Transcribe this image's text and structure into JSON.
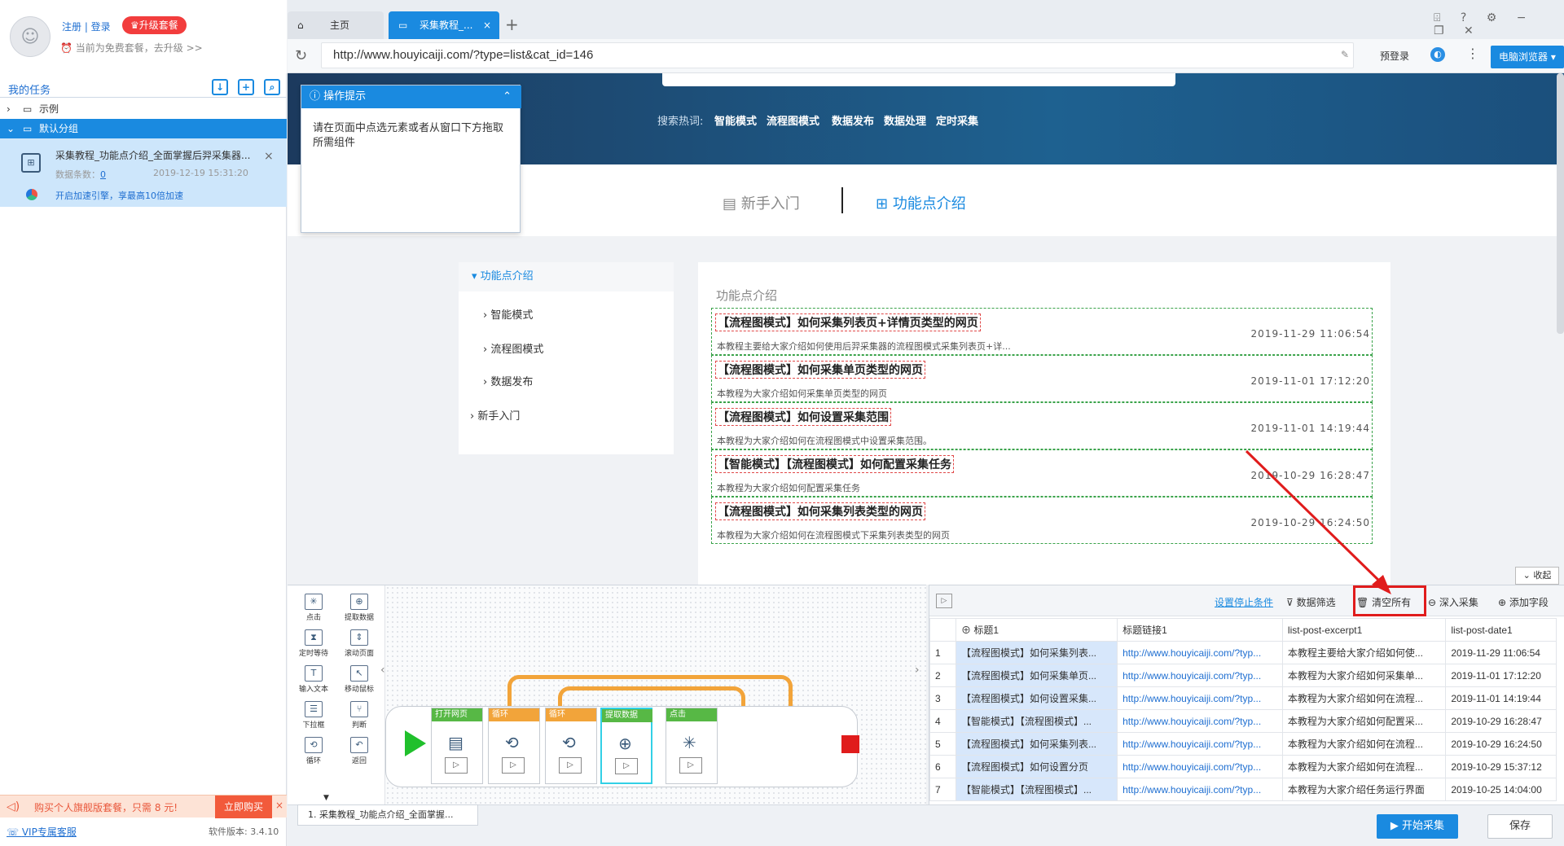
{
  "account": {
    "register_login": "注册 | 登录",
    "upgrade": "♛升级套餐",
    "plan_text": "当前为免费套餐，去升级 >>"
  },
  "tasks": {
    "header": "我的任务",
    "example_folder": "示例",
    "default_folder": "默认分组",
    "task_title": "采集教程_功能点介绍_全面掌握后羿采集器...",
    "task_count_label": "数据条数：",
    "task_count": "0",
    "task_time": "2019-12-19 15:31:20",
    "boost_text": "开启加速引擎，享最高10倍加速"
  },
  "promo": {
    "text": "购买个人旗舰版套餐，只需 8 元!",
    "buy": "立即购买"
  },
  "footer": {
    "vip": "VIP专属客服",
    "version": "软件版本: 3.4.10"
  },
  "browser": {
    "tab_home": "主页",
    "tab_active": "采集教程_...",
    "url": "http://www.houyicaiji.com/?type=list&cat_id=146",
    "prelogin": "预登录",
    "pc_browser": "电脑浏览器 ▾"
  },
  "page": {
    "hot_label": "搜索热词:",
    "hot_words": [
      "智能模式",
      "流程图模式",
      "数据发布",
      "数据处理",
      "定时采集"
    ],
    "nav_beginner": "新手入门",
    "nav_features": "功能点介绍",
    "menu_head": "功能点介绍",
    "menu_items": [
      "智能模式",
      "流程图模式",
      "数据发布",
      "新手入门"
    ],
    "content_title": "功能点介绍",
    "articles": [
      {
        "title": "【流程图模式】如何采集列表页+详情页类型的网页",
        "date": "2019-11-29 11:06:54",
        "excerpt": "本教程主要给大家介绍如何使用后羿采集器的流程图模式采集列表页+详..."
      },
      {
        "title": "【流程图模式】如何采集单页类型的网页",
        "date": "2019-11-01 17:12:20",
        "excerpt": "本教程为大家介绍如何采集单页类型的网页"
      },
      {
        "title": "【流程图模式】如何设置采集范围",
        "date": "2019-11-01 14:19:44",
        "excerpt": "本教程为大家介绍如何在流程图模式中设置采集范围。"
      },
      {
        "title": "【智能模式】【流程图模式】如何配置采集任务",
        "date": "2019-10-29 16:28:47",
        "excerpt": "本教程为大家介绍如何配置采集任务"
      },
      {
        "title": "【流程图模式】如何采集列表类型的网页",
        "date": "2019-10-29 16:24:50",
        "excerpt": "本教程为大家介绍如何在流程图模式下采集列表类型的网页"
      }
    ]
  },
  "tips": {
    "title": "操作提示",
    "body": "请在页面中点选元素或者从窗口下方拖取所需组件"
  },
  "collapse": "收起",
  "palette": [
    "点击",
    "提取数据",
    "定时等待",
    "滚动页面",
    "输入文本",
    "移动鼠标",
    "下拉框",
    "判断",
    "循环",
    "返回"
  ],
  "flow_nodes": [
    "打开网页",
    "循环",
    "循环",
    "提取数据",
    "点击"
  ],
  "flow_tab": "1. 采集教程_功能点介绍_全面掌握...",
  "data_toolbar": {
    "stop_cond": "设置停止条件",
    "filter": "数据筛选",
    "clear_all": "清空所有",
    "deep": "深入采集",
    "add_field": "添加字段"
  },
  "grid": {
    "columns": [
      "标题1",
      "标题链接1",
      "list-post-excerpt1",
      "list-post-date1"
    ],
    "rows": [
      [
        "1",
        "【流程图模式】如何采集列表...",
        "http://www.houyicaiji.com/?typ...",
        "本教程主要给大家介绍如何使...",
        "2019-11-29 11:06:54"
      ],
      [
        "2",
        "【流程图模式】如何采集单页...",
        "http://www.houyicaiji.com/?typ...",
        "本教程为大家介绍如何采集单...",
        "2019-11-01 17:12:20"
      ],
      [
        "3",
        "【流程图模式】如何设置采集...",
        "http://www.houyicaiji.com/?typ...",
        "本教程为大家介绍如何在流程...",
        "2019-11-01 14:19:44"
      ],
      [
        "4",
        "【智能模式】【流程图模式】...",
        "http://www.houyicaiji.com/?typ...",
        "本教程为大家介绍如何配置采...",
        "2019-10-29 16:28:47"
      ],
      [
        "5",
        "【流程图模式】如何采集列表...",
        "http://www.houyicaiji.com/?typ...",
        "本教程为大家介绍如何在流程...",
        "2019-10-29 16:24:50"
      ],
      [
        "6",
        "【流程图模式】如何设置分页",
        "http://www.houyicaiji.com/?typ...",
        "本教程为大家介绍如何在流程...",
        "2019-10-29 15:37:12"
      ],
      [
        "7",
        "【智能模式】【流程图模式】...",
        "http://www.houyicaiji.com/?typ...",
        "本教程为大家介绍任务运行界面",
        "2019-10-25 14:04:00"
      ]
    ]
  },
  "actions": {
    "start": "▶ 开始采集",
    "save": "保存"
  }
}
